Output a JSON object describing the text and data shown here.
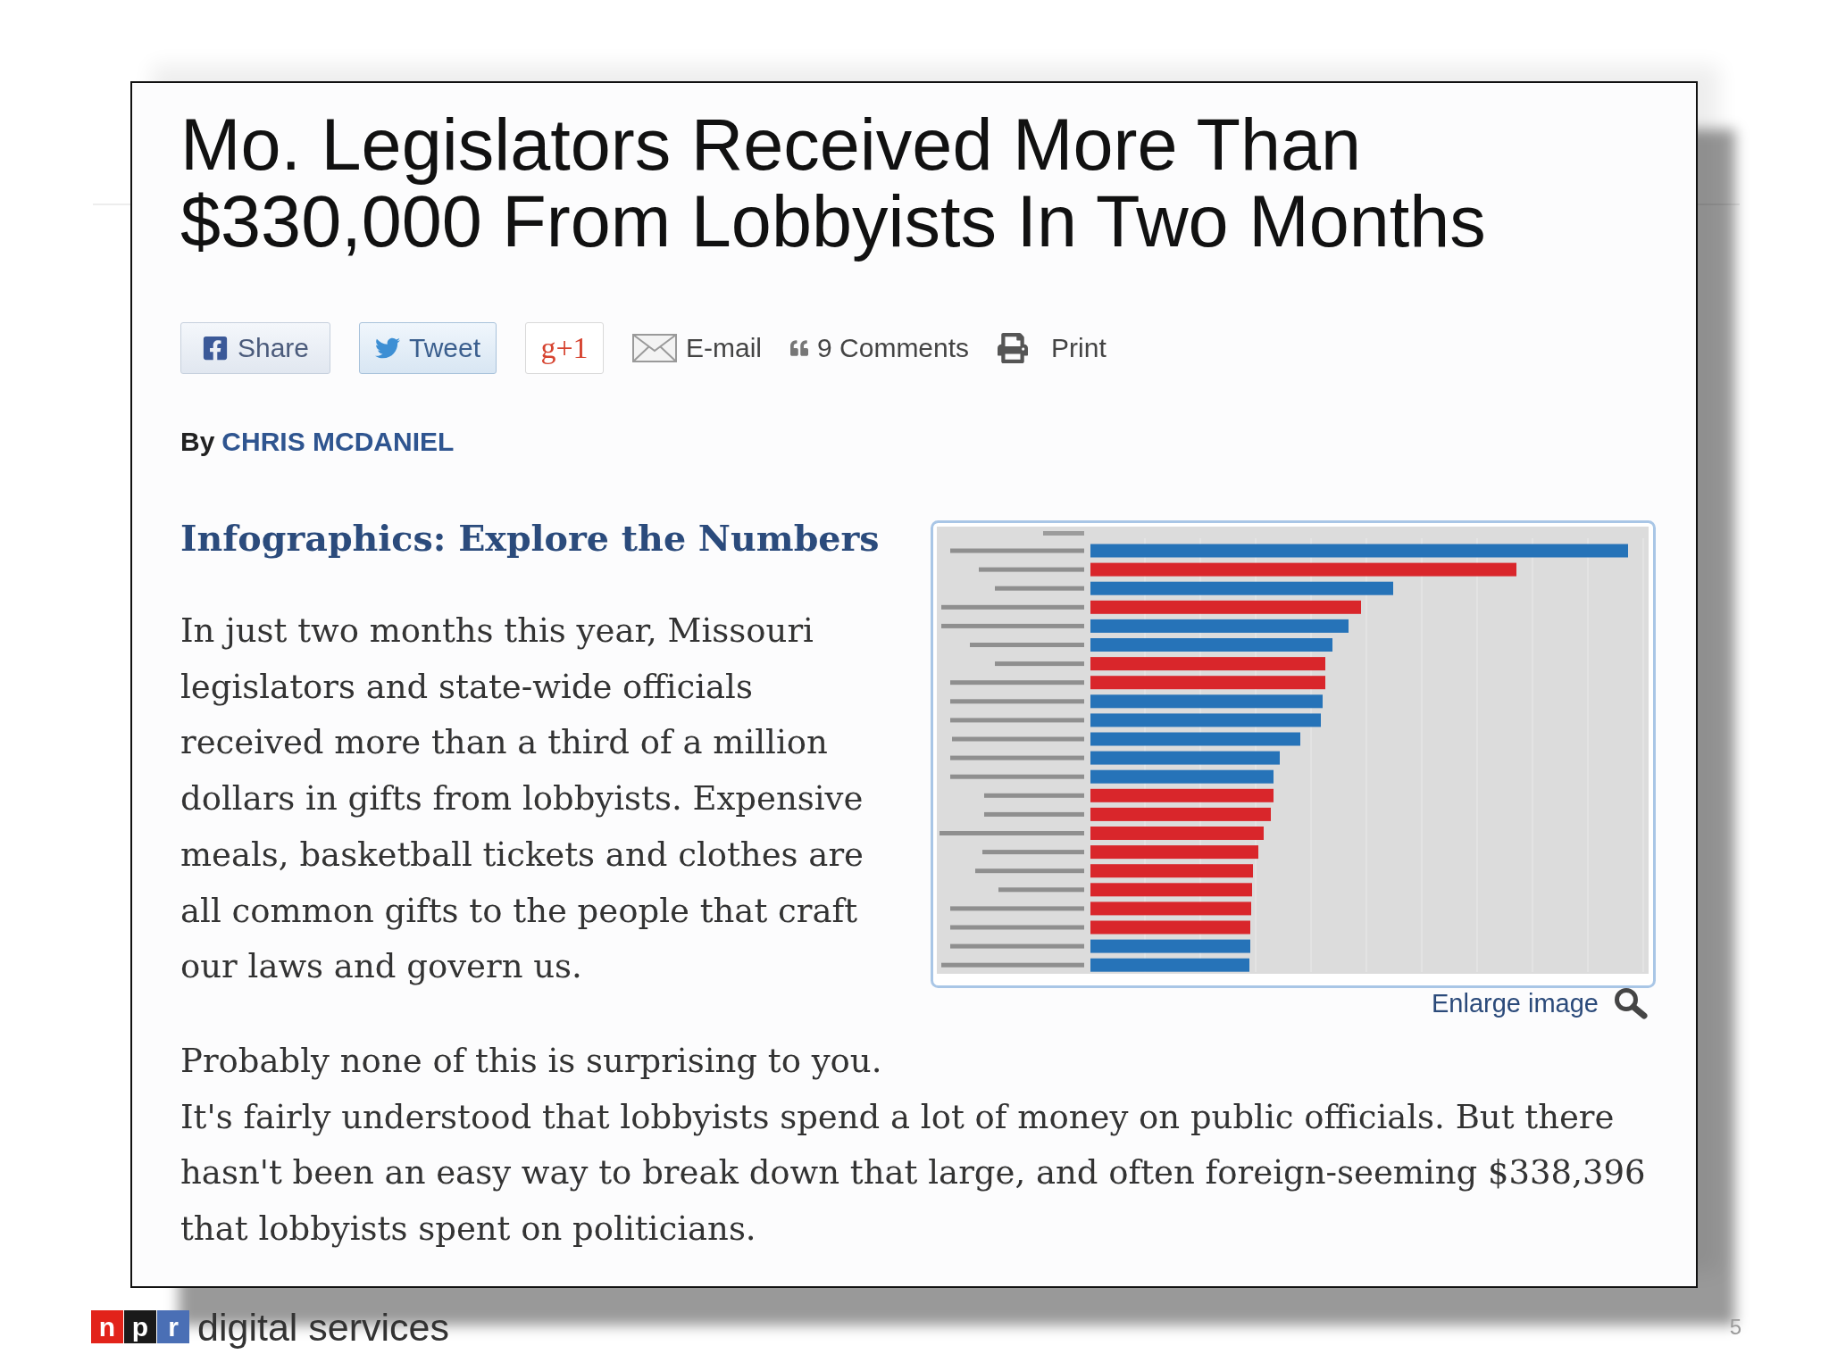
{
  "article": {
    "headline": "Mo. Legislators Received More Than $330,000 From Lobbyists In Two Months",
    "share_bar": [
      {
        "kind": "share",
        "label": "Share"
      },
      {
        "kind": "tweet",
        "label": "Tweet"
      },
      {
        "kind": "plusone",
        "label": "g+1"
      },
      {
        "kind": "email",
        "label": "E-mail"
      },
      {
        "kind": "comments",
        "label": "9 Comments"
      },
      {
        "kind": "print",
        "label": "Print"
      }
    ],
    "byline": {
      "prefix": "By",
      "author": "CHRIS MCDANIEL"
    },
    "infographic": {
      "heading": "Infographics: Explore the Numbers",
      "enlarge_link": "Enlarge image"
    },
    "intro": "In just two months this year, Missouri legislators and state-wide officials received more than a third of a million dollars in gifts from lobbyists. Expensive meals, basketball tickets and clothes are all common gifts to the people that craft our laws and govern us.",
    "paragraphs": [
      "Probably none of this is surprising to you.",
      "It's fairly understood that lobbyists spend a lot of money on public officials. But there hasn't been an easy way to break down that large, and often foreign-seeming $338,396 that lobbyists spent on politicians."
    ]
  },
  "footer": {
    "brand": {
      "tiles": [
        {
          "letter": "n",
          "color": "#e2231a"
        },
        {
          "letter": "p",
          "color": "#1a1a1a"
        },
        {
          "letter": "r",
          "color": "#4a6fb5"
        }
      ],
      "label": "digital services"
    },
    "page_number": "5"
  }
}
